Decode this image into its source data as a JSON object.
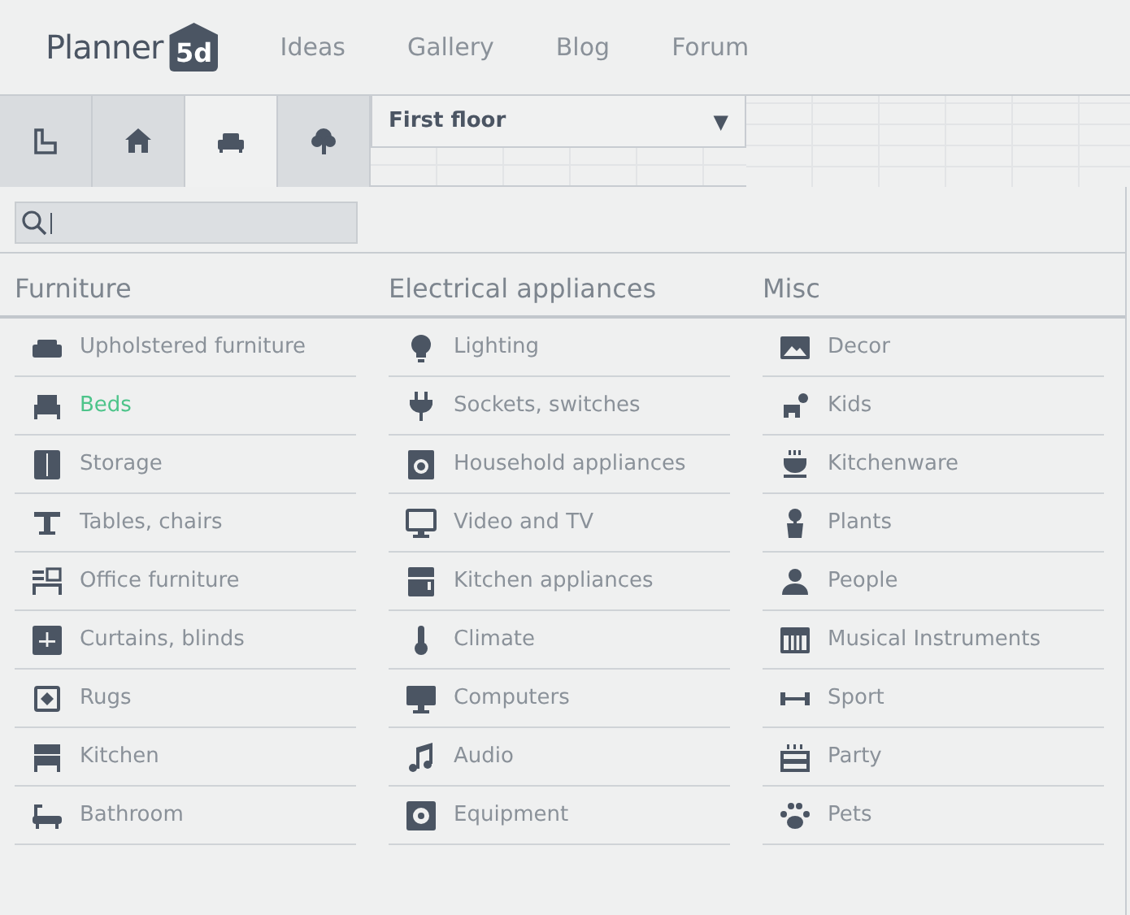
{
  "header": {
    "logo": {
      "text": "Planner",
      "badge": "5d"
    },
    "nav": [
      "Ideas",
      "Gallery",
      "Blog",
      "Forum"
    ]
  },
  "toolbar": {
    "tabs": [
      {
        "selected": false
      },
      {
        "selected": false
      },
      {
        "selected": true
      },
      {
        "selected": false
      }
    ],
    "floor_select": {
      "value": "First floor",
      "arrow": "▼"
    }
  },
  "categories": [
    {
      "title": "Furniture",
      "items": [
        {
          "label": "Upholstered furniture",
          "selected": false
        },
        {
          "label": "Beds",
          "selected": true
        },
        {
          "label": "Storage",
          "selected": false
        },
        {
          "label": "Tables, chairs",
          "selected": false
        },
        {
          "label": "Office furniture",
          "selected": false
        },
        {
          "label": "Curtains, blinds",
          "selected": false
        },
        {
          "label": "Rugs",
          "selected": false
        },
        {
          "label": "Kitchen",
          "selected": false
        },
        {
          "label": "Bathroom",
          "selected": false
        }
      ]
    },
    {
      "title": "Electrical appliances",
      "items": [
        {
          "label": "Lighting",
          "selected": false
        },
        {
          "label": "Sockets, switches",
          "selected": false
        },
        {
          "label": "Household appliances",
          "selected": false
        },
        {
          "label": "Video and TV",
          "selected": false
        },
        {
          "label": "Kitchen appliances",
          "selected": false
        },
        {
          "label": "Climate",
          "selected": false
        },
        {
          "label": "Computers",
          "selected": false
        },
        {
          "label": "Audio",
          "selected": false
        },
        {
          "label": "Equipment",
          "selected": false
        }
      ]
    },
    {
      "title": "Misc",
      "items": [
        {
          "label": "Decor",
          "selected": false
        },
        {
          "label": "Kids",
          "selected": false
        },
        {
          "label": "Kitchenware",
          "selected": false
        },
        {
          "label": "Plants",
          "selected": false
        },
        {
          "label": "People",
          "selected": false
        },
        {
          "label": "Musical Instruments",
          "selected": false
        },
        {
          "label": "Sport",
          "selected": false
        },
        {
          "label": "Party",
          "selected": false
        },
        {
          "label": "Pets",
          "selected": false
        }
      ]
    }
  ]
}
